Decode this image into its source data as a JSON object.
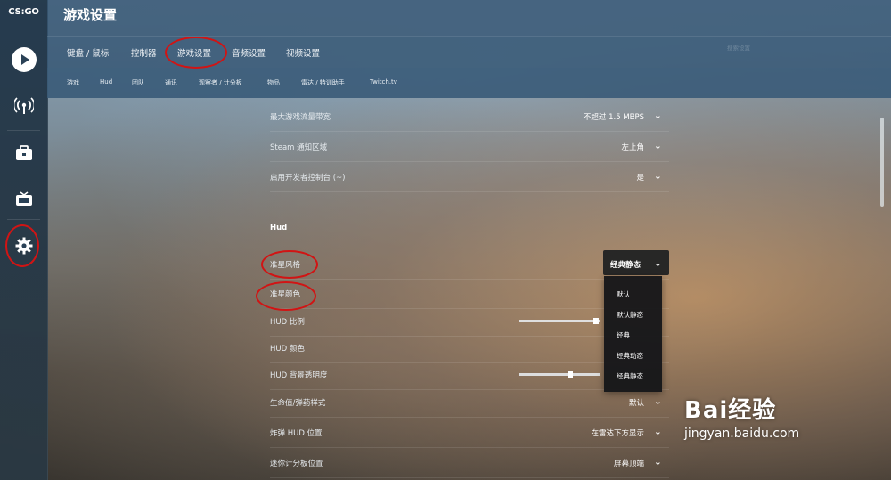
{
  "sidebar": {
    "logo": "CS:GO"
  },
  "header": {
    "title": "游戏设置",
    "tabs": [
      "键盘 / 鼠标",
      "控制器",
      "游戏设置",
      "音频设置",
      "视频设置"
    ],
    "subtabs": [
      "游戏",
      "Hud",
      "团队",
      "通讯",
      "观察者 / 计分板",
      "物品",
      "雷达 / 特训助手",
      "Twitch.tv"
    ],
    "search_hint": "搜索设置"
  },
  "settings": {
    "rows_top": [
      {
        "label": "最大游戏流量带宽",
        "value": "不超过 1.5 MBPS"
      },
      {
        "label": "Steam 通知区域",
        "value": "左上角"
      },
      {
        "label": "启用开发者控制台 (~)",
        "value": "是"
      }
    ],
    "hud_section": "Hud",
    "crosshair_style": {
      "label": "准星风格",
      "value": "经典静态"
    },
    "crosshair_color": {
      "label": "准星颜色"
    },
    "hud_scale": {
      "label": "HUD 比例",
      "level": 0.95
    },
    "hud_color": {
      "label": "HUD 颜色"
    },
    "hud_bg_opacity": {
      "label": "HUD 背景透明度",
      "level": 0.63
    },
    "health_style": {
      "label": "生命值/弹药样式",
      "value": "默认"
    },
    "bomb_hud": {
      "label": "炸弹 HUD 位置",
      "value": "在雷达下方显示"
    },
    "mini_scoreboard": {
      "label": "迷你计分板位置",
      "value": "屏幕顶端"
    }
  },
  "dropdown": {
    "options": [
      "默认",
      "默认静态",
      "经典",
      "经典动态",
      "经典静态"
    ]
  },
  "watermark": {
    "main": "Bai经验",
    "sub": "jingyan.baidu.com"
  },
  "colors": {
    "annotation_red": "#d11414",
    "header_blue": "#34546f"
  }
}
